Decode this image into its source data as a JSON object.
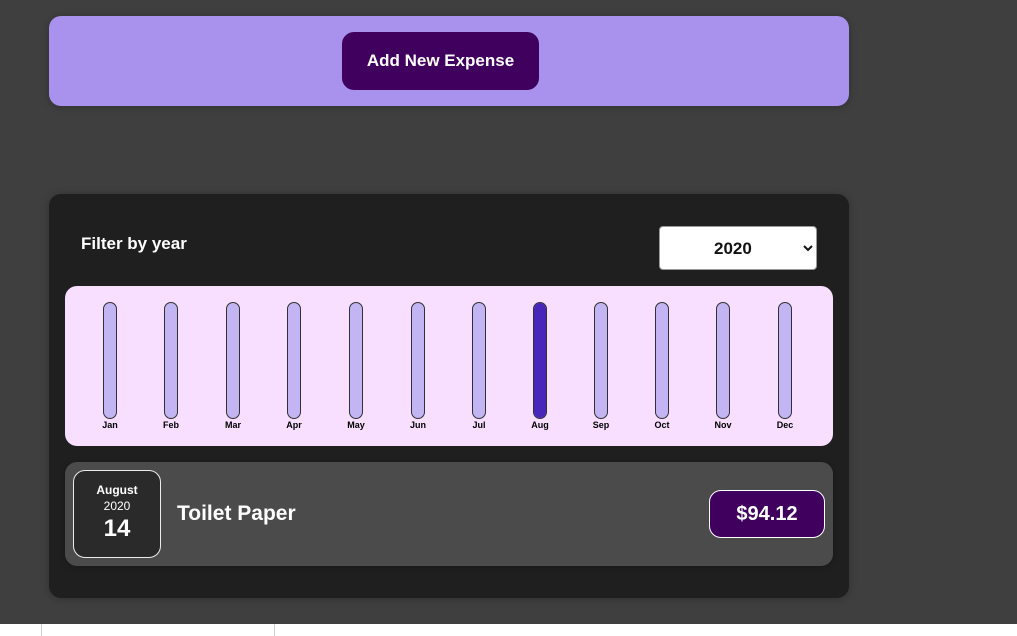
{
  "new_expense": {
    "add_button_label": "Add New Expense"
  },
  "filter": {
    "label": "Filter by year",
    "selected_year": "2020",
    "options": [
      "2020"
    ]
  },
  "chart": {
    "bars": [
      {
        "label": "Jan",
        "fill": 0
      },
      {
        "label": "Feb",
        "fill": 0
      },
      {
        "label": "Mar",
        "fill": 0
      },
      {
        "label": "Apr",
        "fill": 0
      },
      {
        "label": "May",
        "fill": 0
      },
      {
        "label": "Jun",
        "fill": 0
      },
      {
        "label": "Jul",
        "fill": 0
      },
      {
        "label": "Aug",
        "fill": 1
      },
      {
        "label": "Sep",
        "fill": 0
      },
      {
        "label": "Oct",
        "fill": 0
      },
      {
        "label": "Nov",
        "fill": 0
      },
      {
        "label": "Dec",
        "fill": 0
      }
    ]
  },
  "expenses": [
    {
      "month": "August",
      "year": "2020",
      "day": "14",
      "title": "Toilet Paper",
      "amount": "$94.12"
    }
  ],
  "colors": {
    "accent": "#40005d",
    "banner": "#a892ee",
    "bar_fill": "#4826b9",
    "bar_empty": "#c3b4f3",
    "chart_bg": "#f8dfff"
  }
}
